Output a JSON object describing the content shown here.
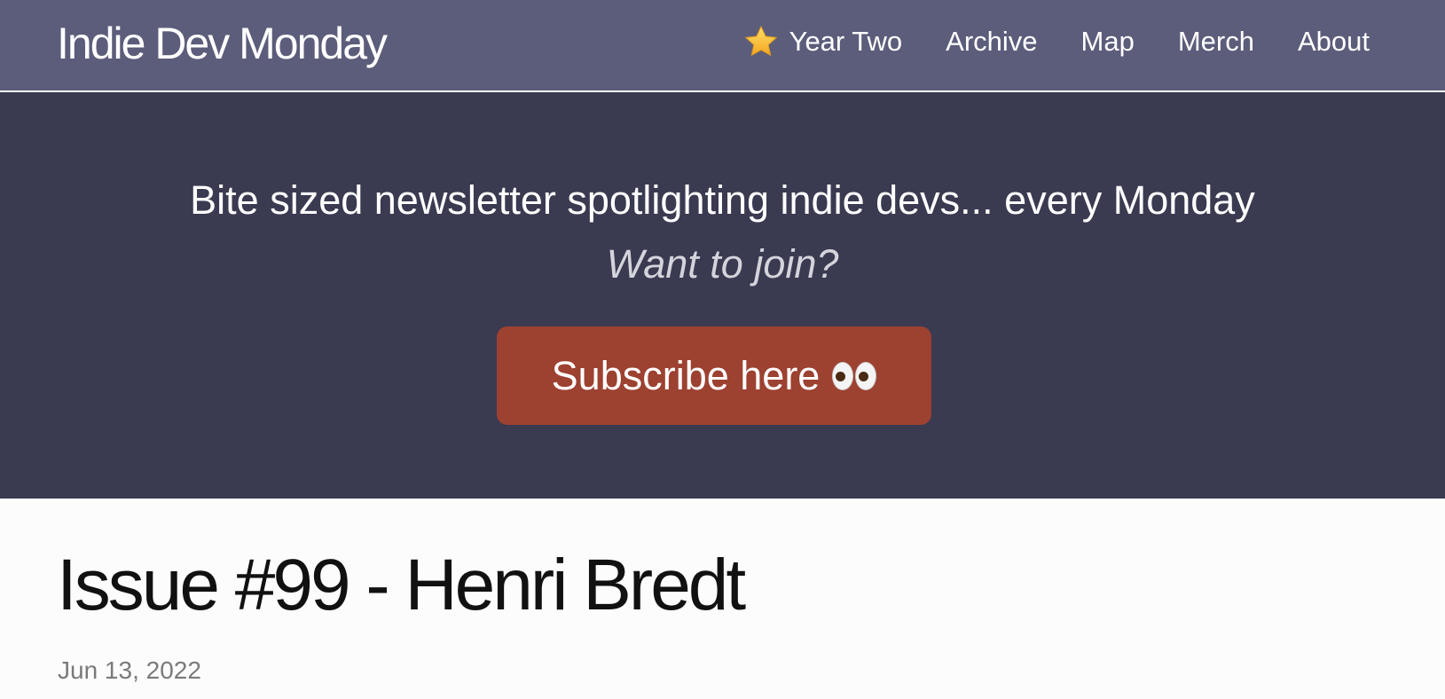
{
  "header": {
    "site_title": "Indie Dev Monday",
    "nav": [
      {
        "label": "Year Two",
        "icon": "star-icon"
      },
      {
        "label": "Archive"
      },
      {
        "label": "Map"
      },
      {
        "label": "Merch"
      },
      {
        "label": "About"
      }
    ]
  },
  "hero": {
    "tagline": "Bite sized newsletter spotlighting indie devs... every Monday",
    "cta_text": "Want to join?",
    "subscribe_label": "Subscribe here",
    "subscribe_icon": "eyes-icon"
  },
  "article": {
    "title": "Issue #99 - Henri Bredt",
    "date": "Jun 13, 2022"
  },
  "colors": {
    "header_bg": "#5c5d7b",
    "hero_bg": "#3a3a51",
    "button_bg": "#9d4131",
    "page_bg": "#fcfcfc"
  }
}
